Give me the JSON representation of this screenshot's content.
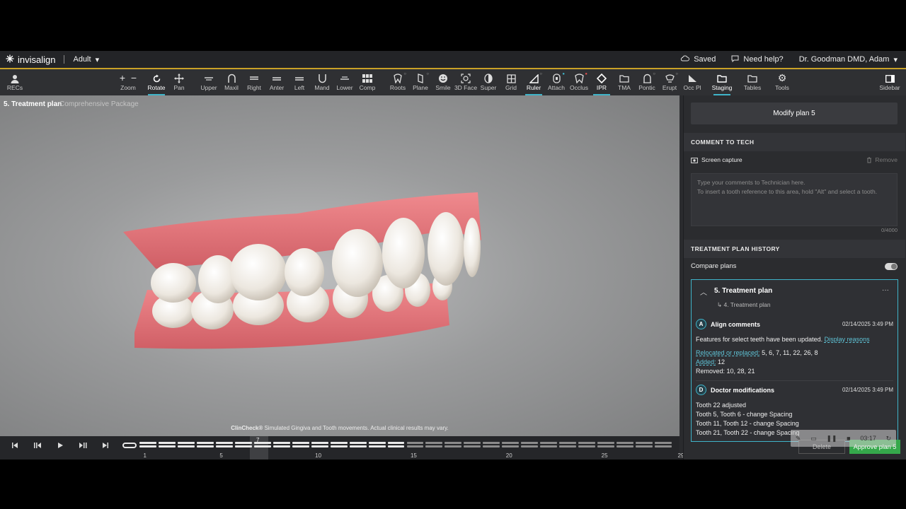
{
  "topbar": {
    "brand": "invisalign",
    "mode": "Adult",
    "saved": "Saved",
    "help": "Need help?",
    "user": "Dr. Goodman DMD, Adam"
  },
  "toolbar": {
    "recs": "RECs",
    "zoom": "Zoom",
    "rotate": "Rotate",
    "pan": "Pan",
    "upper": "Upper",
    "maxil": "Maxil",
    "right": "Right",
    "anter": "Anter",
    "left": "Left",
    "mand": "Mand",
    "lower": "Lower",
    "comp": "Comp",
    "roots": "Roots",
    "plane": "Plane",
    "smile": "Smile",
    "face3d": "3D Face",
    "super": "Super",
    "grid": "Grid",
    "ruler": "Ruler",
    "attach": "Attach",
    "occlus": "Occlus",
    "ipr": "IPR",
    "tma": "TMA",
    "pontic": "Pontic",
    "erupt": "Erupt",
    "occpl": "Occ Pl",
    "staging": "Staging",
    "tables": "Tables",
    "tools": "Tools",
    "sidebar": "Sidebar"
  },
  "viewport": {
    "title": "5. Treatment plan",
    "package": "Comprehensive Package",
    "disclaimer_brand": "ClinCheck®",
    "disclaimer_text": " Simulated Gingiva and Tooth movements. Actual clinical results may vary."
  },
  "timeline": {
    "current_stage": "7",
    "total_stages": 29,
    "ticks": [
      "1",
      "5",
      "10",
      "15",
      "20",
      "25",
      "29"
    ]
  },
  "sidebar": {
    "modify_button": "Modify plan 5",
    "comment_header": "COMMENT TO TECH",
    "screen_capture": "Screen capture",
    "remove": "Remove",
    "comment_placeholder_1": "Type your comments to Technician here.",
    "comment_placeholder_2": "To insert a tooth reference to this area, hold \"Alt\" and select a tooth.",
    "counter": "0/4000",
    "history_header": "TREATMENT PLAN HISTORY",
    "compare_plans": "Compare plans",
    "plan": {
      "title": "5. Treatment plan",
      "previous": "4. Treatment plan",
      "align": {
        "badge": "A",
        "heading": "Align comments",
        "date": "02/14/2025 3:49 PM",
        "text": "Features for select teeth have been updated.",
        "link": "Display reasons",
        "relocated_label": "Relocated or replaced:",
        "relocated_value": " 5, 6, 7, 11, 22, 26, 8",
        "added_label": "Added:",
        "added_value": " 12",
        "removed": "Removed: 10, 28, 21"
      },
      "doctor": {
        "badge": "D",
        "heading": "Doctor modifications",
        "date": "02/14/2025 3:49 PM",
        "lines": [
          "Tooth 22 adjusted",
          "Tooth 5, Tooth 6 - change Spacing",
          "Tooth 11, Tooth 12 - change Spacing",
          "Tooth 21, Tooth 22 - change Spacing"
        ]
      }
    }
  },
  "footer": {
    "delete": "Delete",
    "approve": "Approve plan 5",
    "recording_time": "03:17"
  }
}
